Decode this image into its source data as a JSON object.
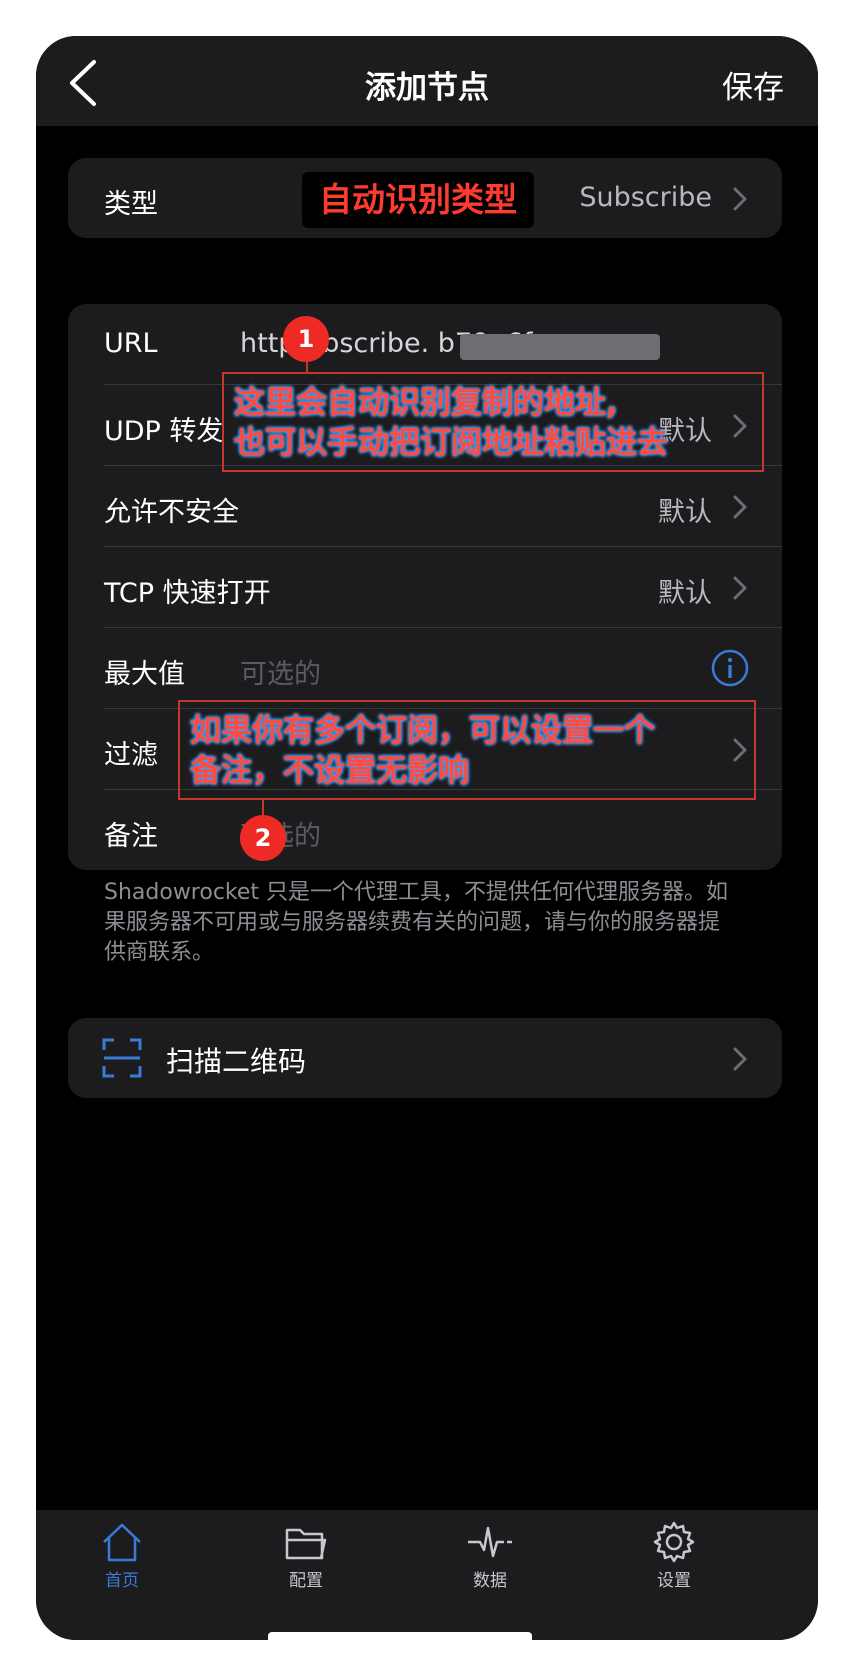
{
  "nav": {
    "title": "添加节点",
    "save_label": "保存"
  },
  "type_row": {
    "label": "类型",
    "chip": "自动识别类型",
    "value": "Subscribe"
  },
  "form": {
    "url": {
      "label": "URL",
      "value": "http:/ bscribe.  b79e6f..."
    },
    "udp": {
      "label": "UDP 转发",
      "value": "默认"
    },
    "insecure": {
      "label": "允许不安全",
      "value": "默认"
    },
    "tcp": {
      "label": "TCP 快速打开",
      "value": "默认"
    },
    "max": {
      "label": "最大值",
      "placeholder": "可选的"
    },
    "filter": {
      "label": "过滤"
    },
    "remark": {
      "label": "备注",
      "placeholder": "可选的"
    }
  },
  "note": "Shadowrocket 只是一个代理工具，不提供任何代理服务器。如果服务器不可用或与服务器续费有关的问题，请与你的服务器提供商联系。",
  "scan": {
    "label": "扫描二维码"
  },
  "tabs": [
    {
      "label": "首页",
      "icon": "home-icon",
      "active": true
    },
    {
      "label": "配置",
      "icon": "folder-icon",
      "active": false
    },
    {
      "label": "数据",
      "icon": "activity-icon",
      "active": false
    },
    {
      "label": "设置",
      "icon": "gear-icon",
      "active": false
    }
  ],
  "annotations": {
    "marker1": "1",
    "marker2": "2",
    "callout1_line1": "这里会自动识别复制的地址,",
    "callout1_line2": "也可以手动把订阅地址粘贴进去",
    "callout2_line1": "如果你有多个订阅，可以设置一个",
    "callout2_line2": "备注，不设置无影响"
  },
  "colors": {
    "accent": "#3a7bd5",
    "annotation_red": "#ff4a3d",
    "background": "#000000",
    "card": "#1c1c1e"
  }
}
